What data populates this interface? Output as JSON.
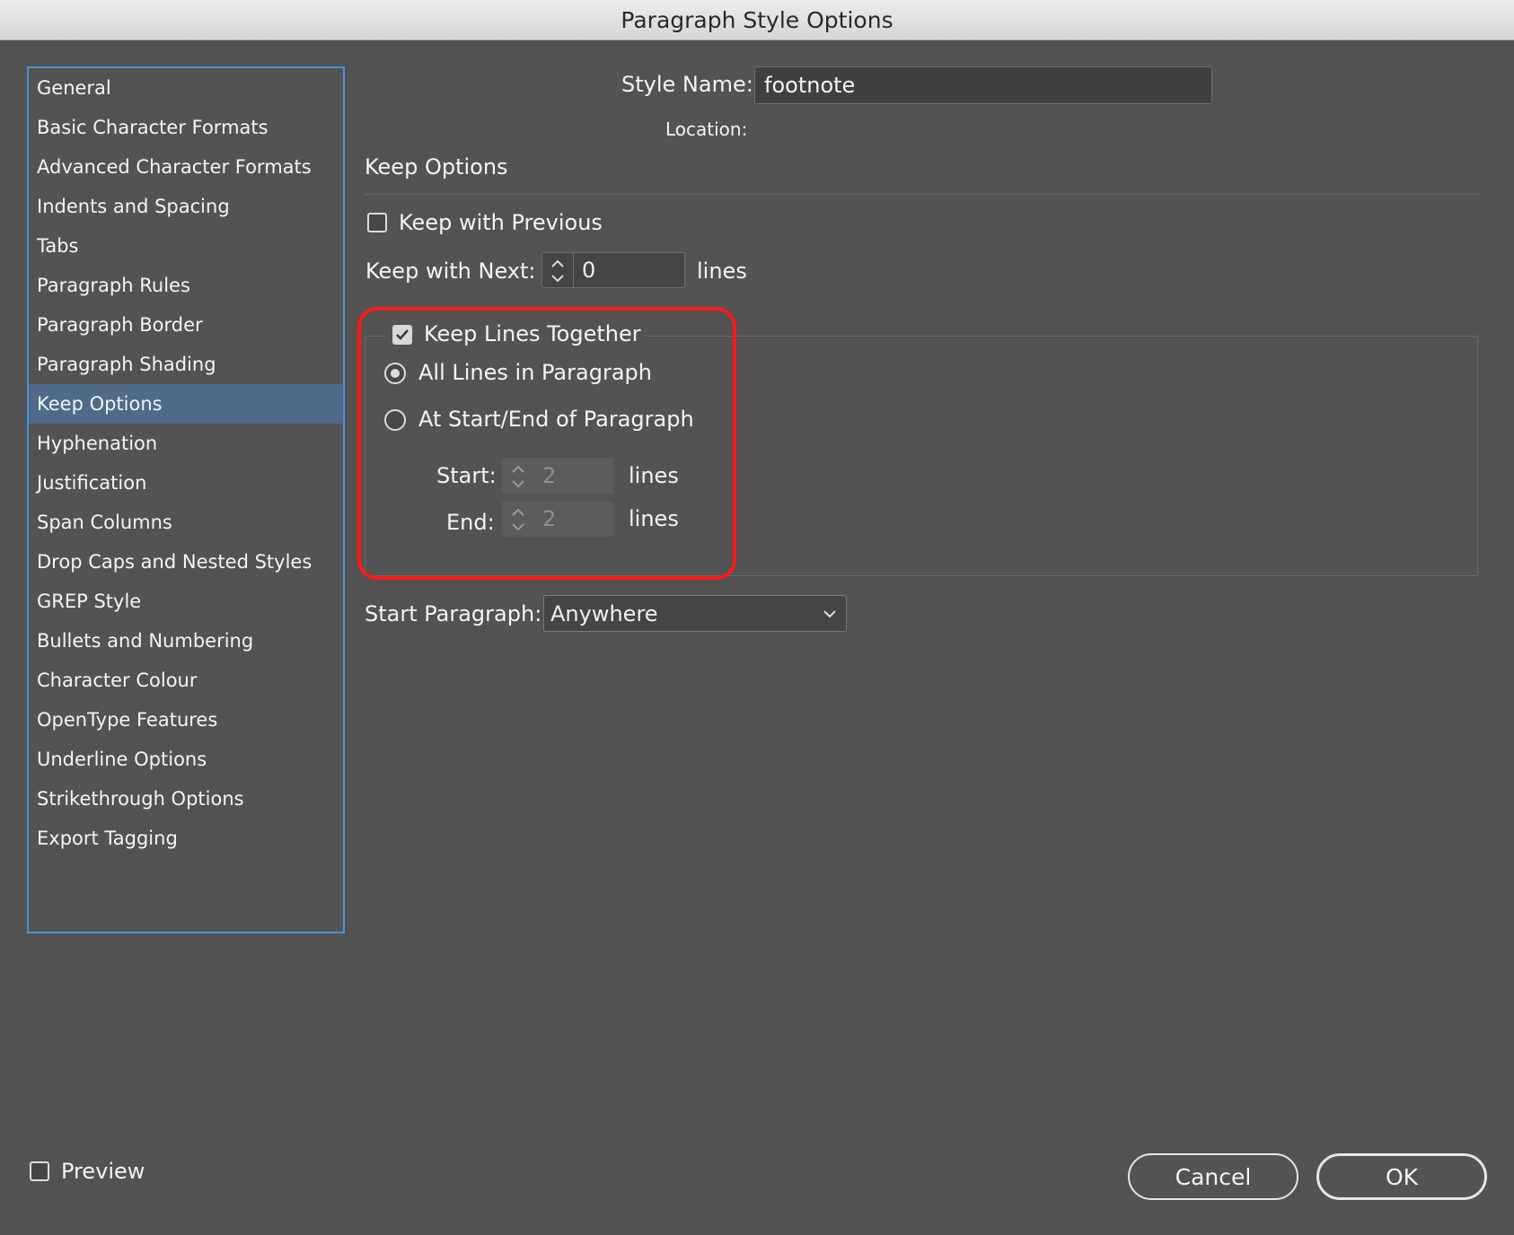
{
  "window": {
    "title": "Paragraph Style Options"
  },
  "sidebar": {
    "items": [
      {
        "label": "General"
      },
      {
        "label": "Basic Character Formats"
      },
      {
        "label": "Advanced Character Formats"
      },
      {
        "label": "Indents and Spacing"
      },
      {
        "label": "Tabs"
      },
      {
        "label": "Paragraph Rules"
      },
      {
        "label": "Paragraph Border"
      },
      {
        "label": "Paragraph Shading"
      },
      {
        "label": "Keep Options",
        "selected": true
      },
      {
        "label": "Hyphenation"
      },
      {
        "label": "Justification"
      },
      {
        "label": "Span Columns"
      },
      {
        "label": "Drop Caps and Nested Styles"
      },
      {
        "label": "GREP Style"
      },
      {
        "label": "Bullets and Numbering"
      },
      {
        "label": "Character Colour"
      },
      {
        "label": "OpenType Features"
      },
      {
        "label": "Underline Options"
      },
      {
        "label": "Strikethrough Options"
      },
      {
        "label": "Export Tagging"
      }
    ]
  },
  "form": {
    "style_name_label": "Style Name:",
    "style_name_value": "footnote",
    "location_label": "Location:",
    "section_title": "Keep Options",
    "keep_with_previous": {
      "label": "Keep with Previous",
      "checked": false
    },
    "keep_with_next": {
      "label": "Keep with Next:",
      "value": "0",
      "unit": "lines"
    },
    "keep_lines_together": {
      "label": "Keep Lines Together",
      "checked": true,
      "option_all": "All Lines in Paragraph",
      "option_startend": "At Start/End of Paragraph",
      "selected": "all",
      "start_label": "Start:",
      "start_value": "2",
      "start_unit": "lines",
      "end_label": "End:",
      "end_value": "2",
      "end_unit": "lines"
    },
    "start_paragraph": {
      "label": "Start Paragraph:",
      "value": "Anywhere"
    }
  },
  "footer": {
    "preview_label": "Preview",
    "preview_checked": false,
    "cancel_label": "Cancel",
    "ok_label": "OK"
  },
  "colors": {
    "highlight": "#ff1a1a",
    "selection": "#4f6b89",
    "sidebar_border": "#4a90d9"
  },
  "icons": [
    "checkmark-icon",
    "stepper-arrows-icon",
    "chevron-down-icon"
  ]
}
